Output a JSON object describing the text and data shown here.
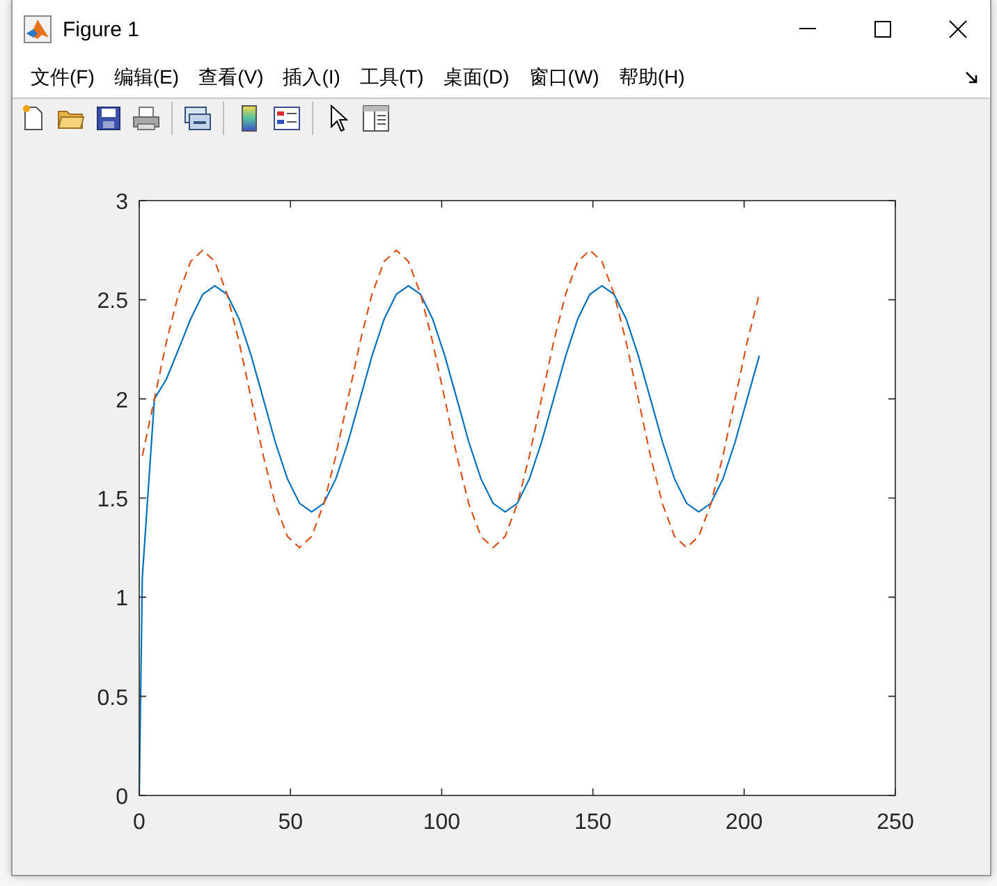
{
  "window": {
    "title": "Figure 1"
  },
  "menu": [
    {
      "label": "文件(F)"
    },
    {
      "label": "编辑(E)"
    },
    {
      "label": "查看(V)"
    },
    {
      "label": "插入(I)"
    },
    {
      "label": "工具(T)"
    },
    {
      "label": "桌面(D)"
    },
    {
      "label": "窗口(W)"
    },
    {
      "label": "帮助(H)"
    }
  ],
  "toolbar": [
    {
      "kind": "new"
    },
    {
      "kind": "open"
    },
    {
      "kind": "save"
    },
    {
      "kind": "print"
    },
    {
      "kind": "separator"
    },
    {
      "kind": "link"
    },
    {
      "kind": "separator"
    },
    {
      "kind": "colorbar"
    },
    {
      "kind": "legend"
    },
    {
      "kind": "separator"
    },
    {
      "kind": "pointer"
    },
    {
      "kind": "inspector"
    }
  ],
  "plot": {
    "chart_data": {
      "type": "line",
      "xlim": [
        0,
        250
      ],
      "ylim": [
        0,
        3
      ],
      "xticks": [
        0,
        50,
        100,
        150,
        200,
        250
      ],
      "yticks": [
        0,
        0.5,
        1,
        1.5,
        2,
        2.5,
        3
      ],
      "x": [
        0,
        1,
        5,
        9,
        13,
        17,
        21,
        25,
        29,
        33,
        37,
        41,
        45,
        49,
        53,
        57,
        61,
        65,
        69,
        73,
        77,
        81,
        85,
        89,
        93,
        97,
        101,
        105,
        109,
        113,
        117,
        121,
        125,
        129,
        133,
        137,
        141,
        145,
        149,
        153,
        157,
        161,
        165,
        169,
        173,
        177,
        181,
        185,
        189,
        193,
        197,
        201,
        205
      ],
      "series": [
        {
          "color": "#0072bd",
          "line_style": "solid",
          "values": [
            0,
            1.1,
            2.0,
            2.1,
            2.25,
            2.403,
            2.527,
            2.57,
            2.527,
            2.403,
            2.218,
            2,
            1.782,
            1.597,
            1.473,
            1.43,
            1.473,
            1.597,
            1.782,
            2,
            2.218,
            2.403,
            2.527,
            2.57,
            2.527,
            2.403,
            2.218,
            2,
            1.782,
            1.597,
            1.473,
            1.43,
            1.473,
            1.597,
            1.782,
            2,
            2.218,
            2.403,
            2.527,
            2.57,
            2.527,
            2.403,
            2.218,
            2,
            1.782,
            1.597,
            1.473,
            1.43,
            1.473,
            1.597,
            1.782,
            2,
            2.218
          ]
        },
        {
          "color": "#d95319",
          "line_style": "dashed",
          "values": [
            null,
            1.713,
            2,
            2.287,
            2.53,
            2.693,
            2.75,
            2.693,
            2.53,
            2.287,
            2,
            1.713,
            1.47,
            1.307,
            1.25,
            1.307,
            1.47,
            1.713,
            2,
            2.287,
            2.53,
            2.693,
            2.75,
            2.693,
            2.53,
            2.287,
            2,
            1.713,
            1.47,
            1.307,
            1.25,
            1.307,
            1.47,
            1.713,
            2,
            2.287,
            2.53,
            2.693,
            2.75,
            2.693,
            2.53,
            2.287,
            2,
            1.713,
            1.47,
            1.307,
            1.25,
            1.307,
            1.47,
            1.713,
            2,
            2.287,
            2.53
          ]
        }
      ]
    }
  }
}
